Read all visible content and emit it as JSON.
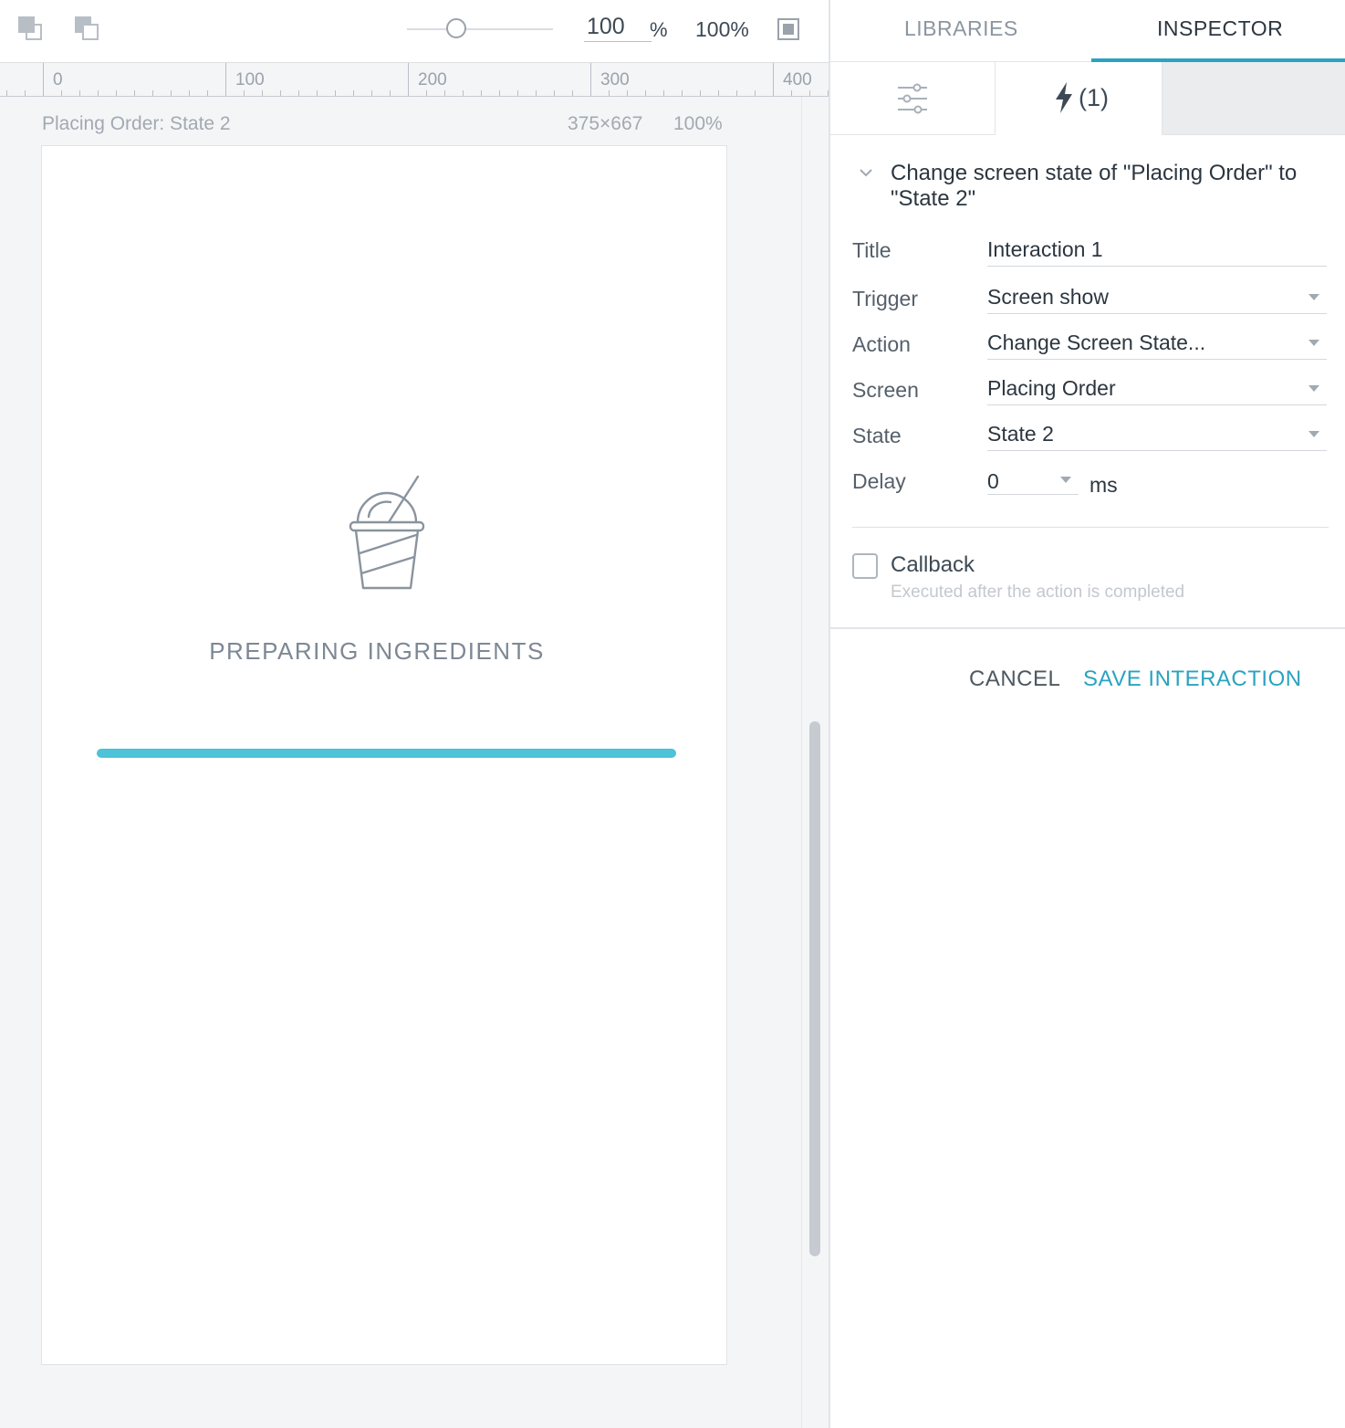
{
  "toolbar": {
    "zoom_value": "100",
    "zoom_unit": "%",
    "zoom_fit_label": "100%",
    "icons": [
      "bring-to-front-icon",
      "send-to-back-icon",
      "fit-screen-icon"
    ]
  },
  "ruler": {
    "labels": [
      "0",
      "100",
      "200",
      "300",
      "400"
    ]
  },
  "canvas": {
    "frame_title": "Placing Order: State 2",
    "frame_size": "375×667",
    "frame_zoom": "100%",
    "artboard": {
      "icon": "drink-cup-icon",
      "loading_text": "PREPARING INGREDIENTS",
      "progress": 1.0,
      "progress_color": "#4cc3d6"
    }
  },
  "inspector": {
    "tabs": [
      "LIBRARIES",
      "INSPECTOR"
    ],
    "active_tab": "INSPECTOR",
    "accent_color": "#2aa3c1",
    "subtabs": {
      "properties_icon": "sliders-icon",
      "interactions_icon": "lightning-bolt-icon",
      "interactions_count": "(1)"
    },
    "interaction": {
      "summary": "Change screen state of \"Placing Order\" to \"State 2\"",
      "rows": [
        {
          "label": "Title",
          "value": "Interaction 1"
        },
        {
          "label": "Trigger",
          "value": "Screen show"
        },
        {
          "label": "Action",
          "value": "Change Screen State..."
        },
        {
          "label": "Screen",
          "value": "Placing Order"
        },
        {
          "label": "State",
          "value": "State 2"
        }
      ],
      "delay": {
        "label": "Delay",
        "value": "0",
        "unit": "ms"
      },
      "callback": {
        "label": "Callback",
        "hint": "Executed after the action is completed",
        "checked": false
      },
      "buttons": {
        "cancel": "CANCEL",
        "save": "SAVE INTERACTION"
      }
    }
  }
}
